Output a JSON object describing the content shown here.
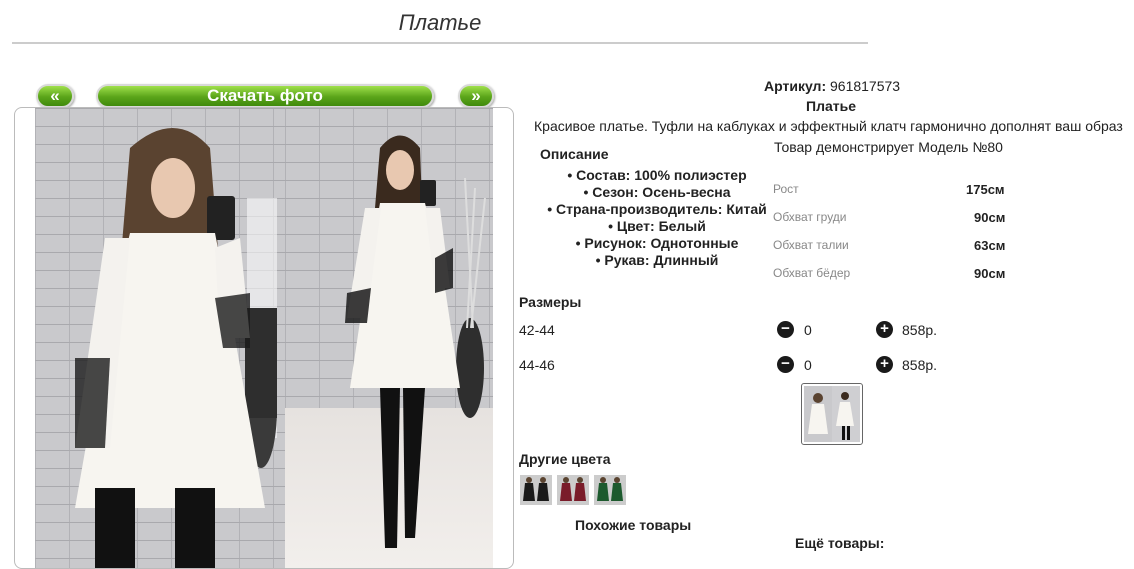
{
  "page": {
    "title": "Платье"
  },
  "gallery": {
    "prev_label": "«",
    "next_label": "»",
    "download_label": "Скачать фото"
  },
  "product": {
    "article_label": "Артикул:",
    "article_value": "961817573",
    "name": "Платье",
    "tagline": "Красивое платье. Туфли на каблуках и эффектный клатч гармонично дополнят ваш образ"
  },
  "description": {
    "heading": "Описание",
    "items": [
      "Состав: 100% полиэстер",
      "Сезон: Осень-весна",
      "Страна-производитель: Китай",
      "Цвет: Белый",
      "Рисунок: Однотонные",
      "Рукав: Длинный"
    ]
  },
  "model": {
    "heading": "Товар демонстрирует Модель №80",
    "rows": [
      {
        "label": "Рост",
        "value": "175см"
      },
      {
        "label": "Обхват груди",
        "value": "90см"
      },
      {
        "label": "Обхват талии",
        "value": "63см"
      },
      {
        "label": "Обхват бёдер",
        "value": "90см"
      }
    ]
  },
  "sizes": {
    "heading": "Размеры",
    "rows": [
      {
        "size": "42-44",
        "qty": "0",
        "price": "858р."
      },
      {
        "size": "44-46",
        "qty": "0",
        "price": "858р."
      }
    ]
  },
  "other_colors": {
    "heading": "Другие цвета"
  },
  "similar": {
    "heading": "Похожие товары"
  },
  "more": {
    "heading": "Ещё товары:"
  },
  "colors": {
    "button_green": "#5aa41a",
    "frame": "#bbbbbb",
    "dress_white": "#f7f5f0"
  }
}
